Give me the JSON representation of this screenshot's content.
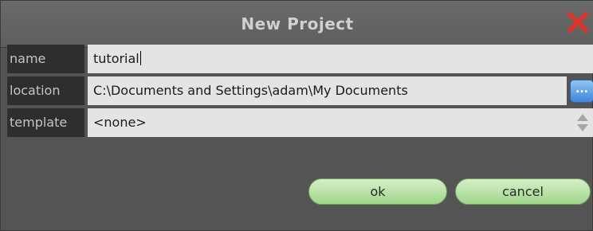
{
  "dialog": {
    "title": "New Project",
    "close_icon": "close-icon"
  },
  "fields": {
    "name": {
      "label": "name",
      "value": "tutorial"
    },
    "location": {
      "label": "location",
      "value": "C:\\Documents and Settings\\adam\\My Documents",
      "browse_label": "..."
    },
    "template": {
      "label": "template",
      "value": "<none>",
      "stepper_icon": "up-down-stepper-icon"
    }
  },
  "buttons": {
    "ok": "ok",
    "cancel": "cancel"
  },
  "colors": {
    "background": "#545454",
    "label_bg": "#2e2e2e",
    "field_bg": "#e4e4e4",
    "close_red": "#d9362b",
    "button_green": "#b8e3a4",
    "browse_blue": "#4a8fdc"
  }
}
